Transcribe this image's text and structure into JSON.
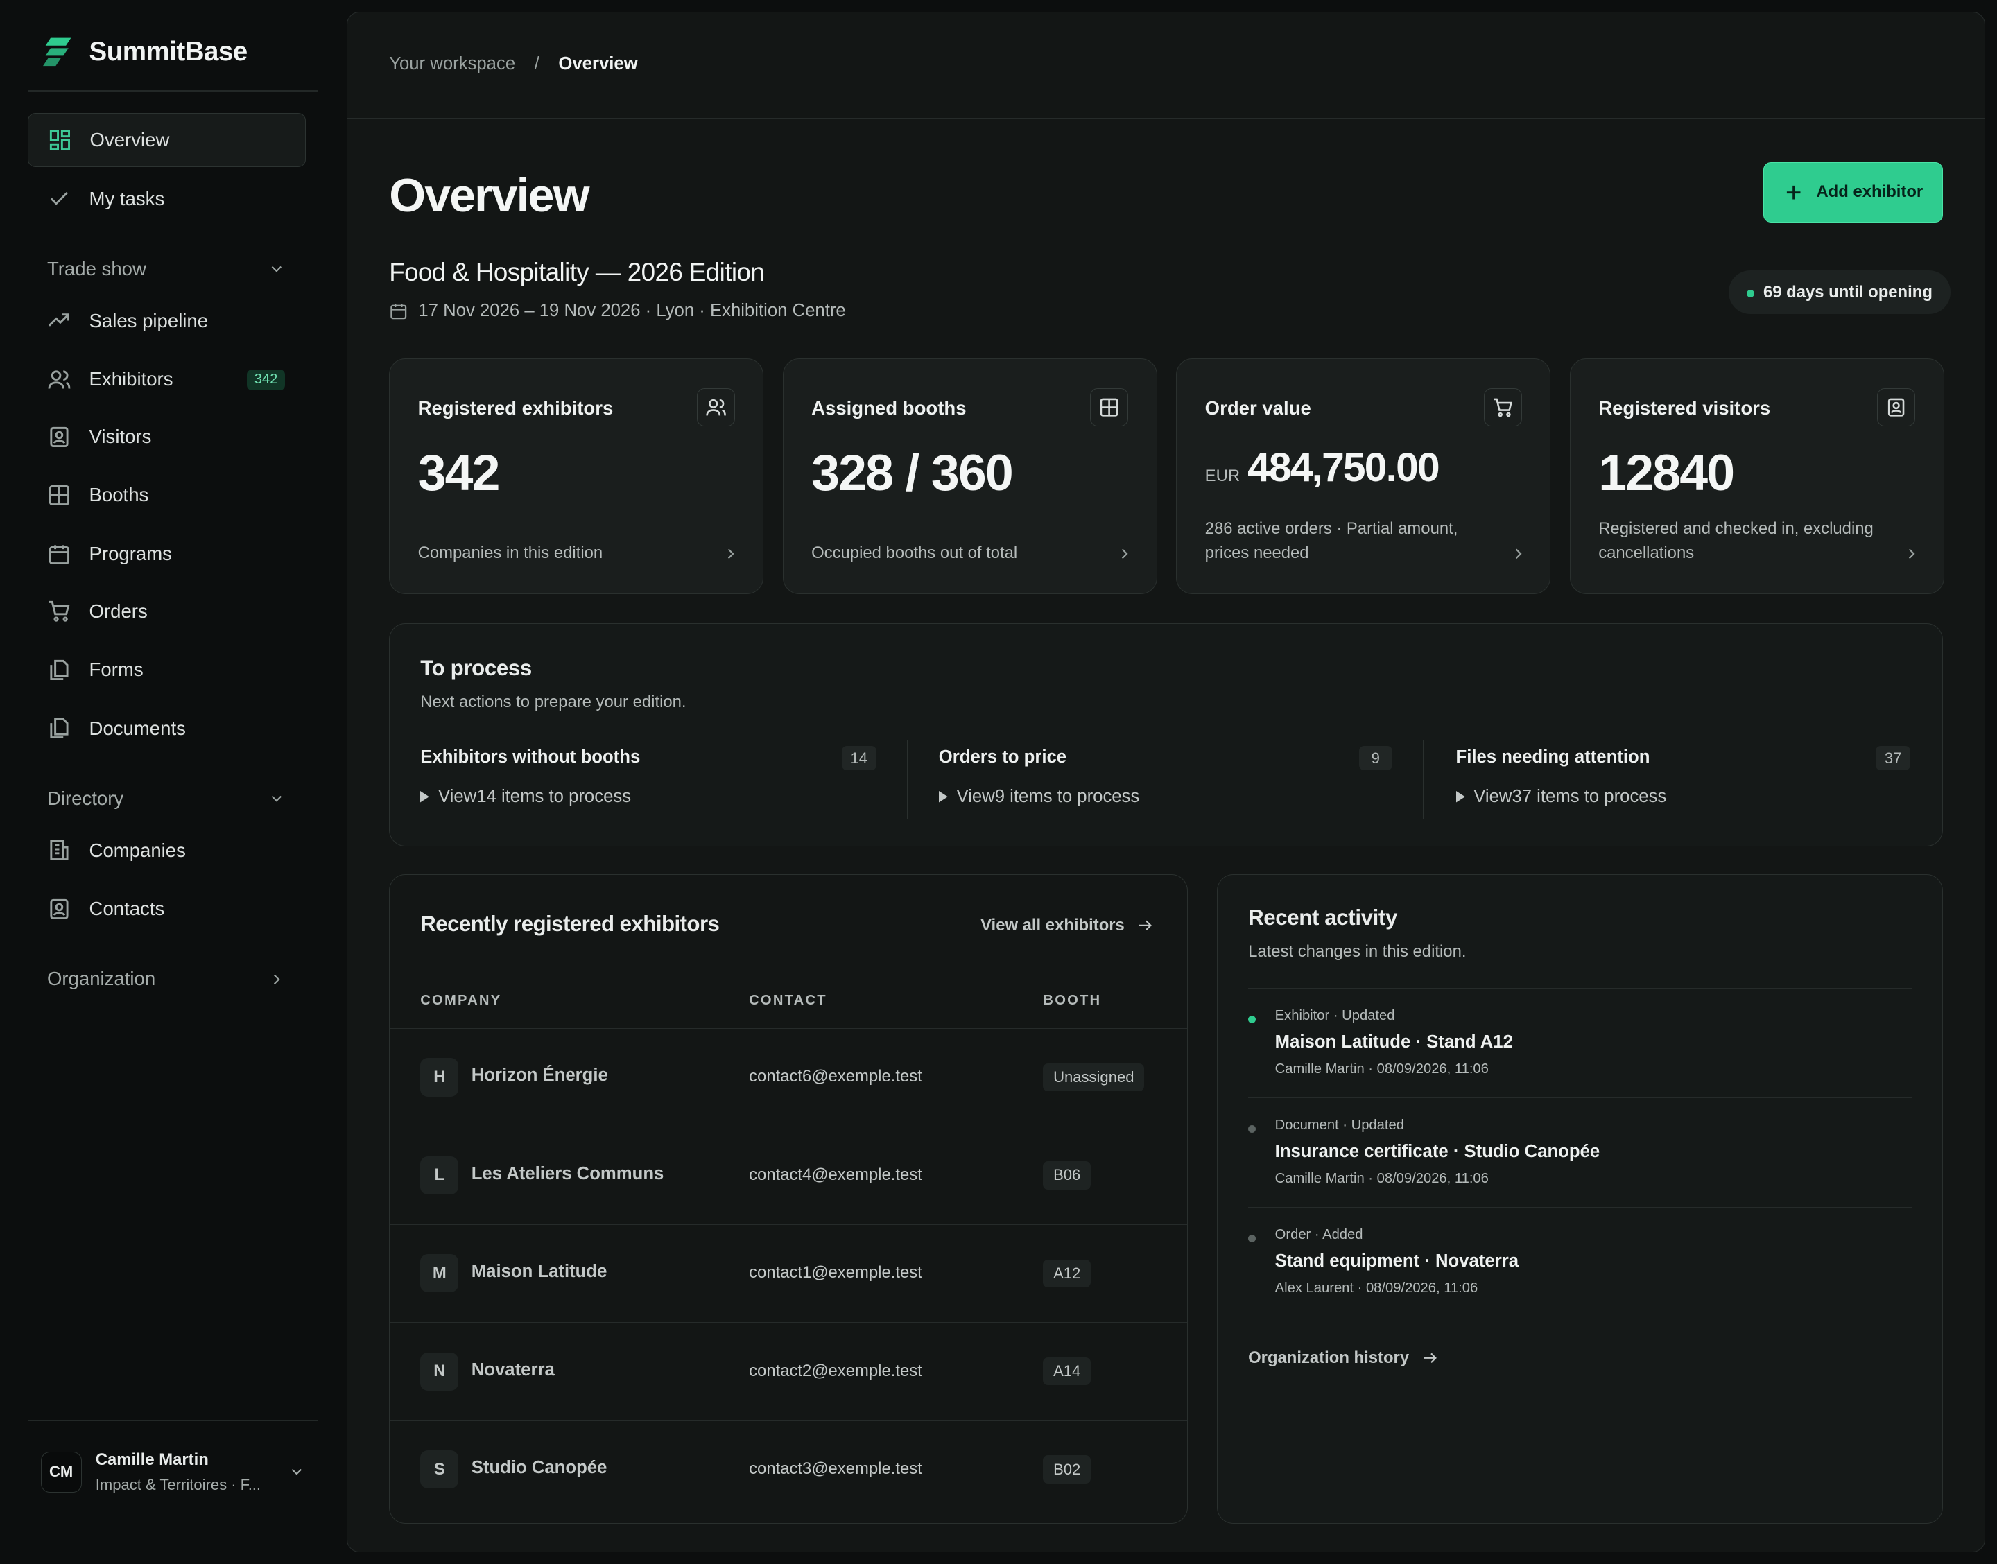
{
  "app": {
    "name": "SummitBase"
  },
  "sidebar": {
    "items": [
      {
        "label": "Overview",
        "icon": "layout-grid-icon",
        "active": true
      },
      {
        "label": "My tasks",
        "icon": "check-icon"
      }
    ],
    "sections": [
      {
        "label": "Trade show",
        "expanded": true,
        "items": [
          {
            "label": "Sales pipeline",
            "icon": "trending-up-icon"
          },
          {
            "label": "Exhibitors",
            "icon": "users-icon",
            "badge": "342"
          },
          {
            "label": "Visitors",
            "icon": "contact-card-icon"
          },
          {
            "label": "Booths",
            "icon": "grid-icon"
          },
          {
            "label": "Programs",
            "icon": "calendar-icon"
          },
          {
            "label": "Orders",
            "icon": "cart-icon"
          },
          {
            "label": "Forms",
            "icon": "files-icon"
          },
          {
            "label": "Documents",
            "icon": "documents-icon"
          }
        ]
      },
      {
        "label": "Directory",
        "expanded": true,
        "items": [
          {
            "label": "Companies",
            "icon": "building-icon"
          },
          {
            "label": "Contacts",
            "icon": "contact-card-icon"
          }
        ]
      },
      {
        "label": "Organization",
        "expanded": false,
        "items": []
      }
    ],
    "user": {
      "initials": "CM",
      "name": "Camille Martin",
      "org": "Impact & Territoires · F..."
    }
  },
  "breadcrumb": {
    "root": "Your workspace",
    "separator": "/",
    "current": "Overview"
  },
  "page": {
    "title": "Overview",
    "add_button": "Add exhibitor"
  },
  "event": {
    "title": "Food & Hospitality — 2026 Edition",
    "meta": "17 Nov 2026 – 19 Nov 2026 · Lyon · Exhibition Centre",
    "countdown": "69 days until opening"
  },
  "stats": [
    {
      "label": "Registered exhibitors",
      "value": "342",
      "desc": "Companies in this edition",
      "icon": "users-icon"
    },
    {
      "label": "Assigned booths",
      "value": "328 / 360",
      "desc": "Occupied booths out of total",
      "icon": "grid-icon"
    },
    {
      "label": "Order value",
      "currency": "EUR",
      "value": "484,750.00",
      "desc": "286 active orders · Partial amount, prices needed",
      "icon": "cart-icon"
    },
    {
      "label": "Registered visitors",
      "value": "12840",
      "desc": "Registered and checked in, excluding cancellations",
      "icon": "contact-card-icon"
    }
  ],
  "to_process": {
    "title": "To process",
    "subtitle": "Next actions to prepare your edition.",
    "items": [
      {
        "title": "Exhibitors without booths",
        "count": "14",
        "view": "View14 items to process"
      },
      {
        "title": "Orders to price",
        "count": "9",
        "view": "View9 items to process"
      },
      {
        "title": "Files needing attention",
        "count": "37",
        "view": "View37 items to process"
      }
    ]
  },
  "exhibitors": {
    "title": "Recently registered exhibitors",
    "view_all": "View all exhibitors",
    "columns": [
      "COMPANY",
      "CONTACT",
      "BOOTH"
    ],
    "rows": [
      {
        "initial": "H",
        "company": "Horizon Énergie",
        "contact": "contact6@exemple.test",
        "booth": "Unassigned"
      },
      {
        "initial": "L",
        "company": "Les Ateliers Communs",
        "contact": "contact4@exemple.test",
        "booth": "B06"
      },
      {
        "initial": "M",
        "company": "Maison Latitude",
        "contact": "contact1@exemple.test",
        "booth": "A12"
      },
      {
        "initial": "N",
        "company": "Novaterra",
        "contact": "contact2@exemple.test",
        "booth": "A14"
      },
      {
        "initial": "S",
        "company": "Studio Canopée",
        "contact": "contact3@exemple.test",
        "booth": "B02"
      }
    ]
  },
  "activity": {
    "title": "Recent activity",
    "subtitle": "Latest changes in this edition.",
    "items": [
      {
        "kind": "Exhibitor · Updated",
        "name": "Maison Latitude · Stand A12",
        "meta": "Camille Martin · 08/09/2026, 11:06"
      },
      {
        "kind": "Document · Updated",
        "name": "Insurance certificate · Studio Canopée",
        "meta": "Camille Martin · 08/09/2026, 11:06"
      },
      {
        "kind": "Order · Added",
        "name": "Stand equipment · Novaterra",
        "meta": "Alex Laurent · 08/09/2026, 11:06"
      }
    ],
    "history_link": "Organization history"
  },
  "colors": {
    "accent": "#2fcc8f",
    "background": "#0c0e0e",
    "panel": "#131615",
    "card": "#1a1e1d"
  }
}
